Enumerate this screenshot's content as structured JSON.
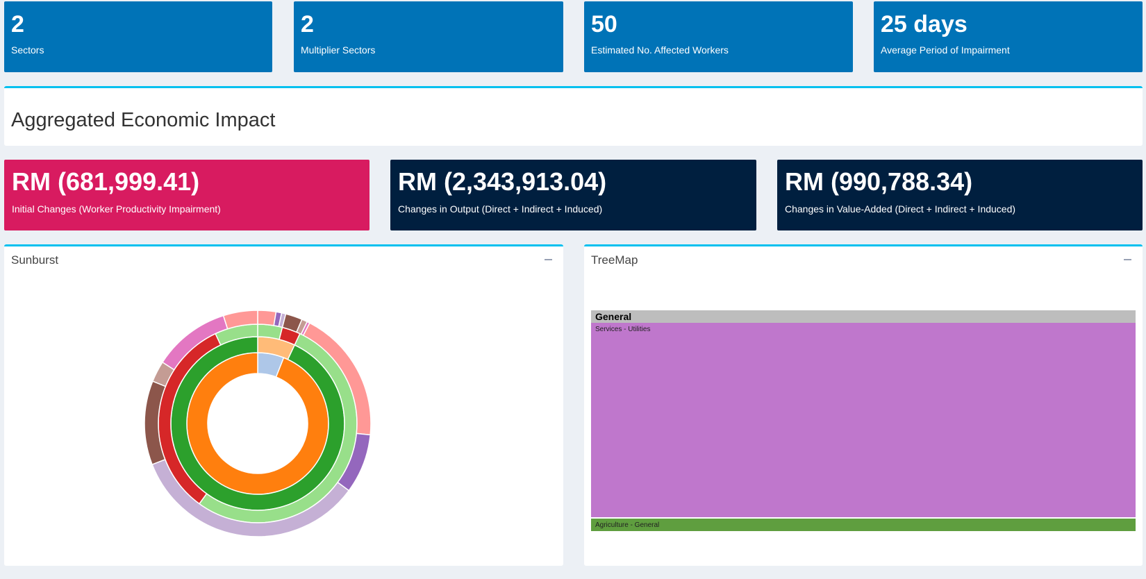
{
  "value_boxes": [
    {
      "value": "2",
      "label": "Sectors"
    },
    {
      "value": "2",
      "label": "Multiplier Sectors"
    },
    {
      "value": "50",
      "label": "Estimated No. Affected Workers"
    },
    {
      "value": "25 days",
      "label": "Average Period of Impairment"
    }
  ],
  "section_title": "Aggregated Economic Impact",
  "impact_boxes": [
    {
      "value": "RM (681,999.41)",
      "label": "Initial Changes (Worker Productivity Impairment)",
      "color": "#d81b60"
    },
    {
      "value": "RM (2,343,913.04)",
      "label": "Changes in Output (Direct + Indirect + Induced)",
      "color": "#001f3f"
    },
    {
      "value": "RM (990,788.34)",
      "label": "Changes in Value-Added (Direct + Indirect + Induced)",
      "color": "#001f3f"
    }
  ],
  "sunburst": {
    "title": "Sunburst",
    "rings": [
      [
        {
          "f": 0.06,
          "c": "#aec7e8"
        },
        {
          "f": 0.94,
          "c": "#ff7f0e"
        }
      ],
      [
        {
          "f": 0.07,
          "c": "#ffbb78"
        },
        {
          "f": 0.93,
          "c": "#2ca02c"
        }
      ],
      [
        {
          "f": 0.04,
          "c": "#98df8a"
        },
        {
          "f": 0.03,
          "c": "#d62728"
        },
        {
          "f": 0.53,
          "c": "#98df8a"
        },
        {
          "f": 0.33,
          "c": "#d62728"
        },
        {
          "f": 0.07,
          "c": "#98df8a"
        }
      ],
      [
        {
          "f": 0.026,
          "c": "#ff9896"
        },
        {
          "f": 0.008,
          "c": "#9467bd"
        },
        {
          "f": 0.006,
          "c": "#c5b0d5"
        },
        {
          "f": 0.024,
          "c": "#8c564b"
        },
        {
          "f": 0.008,
          "c": "#c49c94"
        },
        {
          "f": 0.004,
          "c": "#e377c2"
        },
        {
          "f": 0.19,
          "c": "#ff9896"
        },
        {
          "f": 0.085,
          "c": "#9467bd"
        },
        {
          "f": 0.34,
          "c": "#c5b0d5"
        },
        {
          "f": 0.12,
          "c": "#8c564b"
        },
        {
          "f": 0.03,
          "c": "#c49c94"
        },
        {
          "f": 0.11,
          "c": "#e377c2"
        },
        {
          "f": 0.049,
          "c": "#ff9896"
        }
      ]
    ]
  },
  "treemap": {
    "title": "TreeMap",
    "root_label": "General",
    "cells": [
      {
        "label": "Services - Utilities",
        "share": 0.935,
        "color": "#bf77cc"
      },
      {
        "label": "Agriculture - General",
        "share": 0.065,
        "color": "#5f9e3f"
      }
    ]
  }
}
